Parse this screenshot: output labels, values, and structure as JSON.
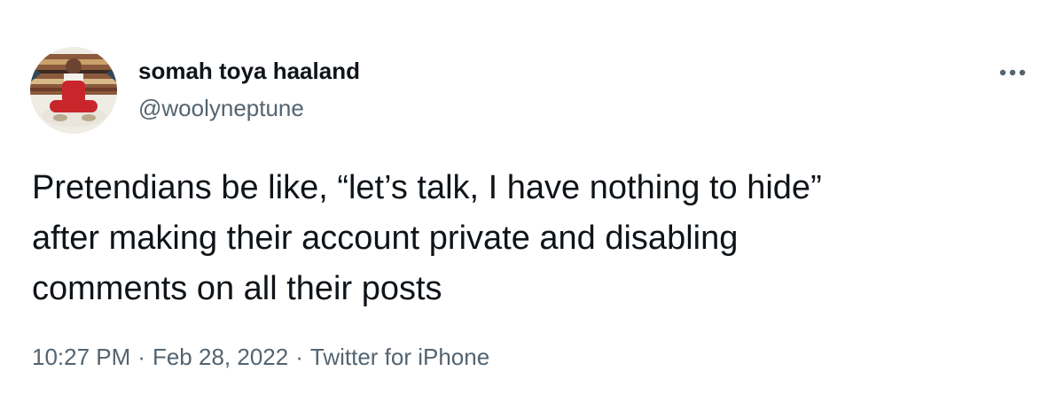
{
  "author": {
    "display_name": "somah toya haaland",
    "handle": "@woolyneptune",
    "avatar": "avatar-photo"
  },
  "more_menu": {
    "icon": "more-horizontal-icon"
  },
  "tweet": {
    "text_lines": [
      "Pretendians be like, “let’s talk, I have nothing to hide”",
      "after making their account private and disabling",
      "comments on all their posts"
    ]
  },
  "meta": {
    "time": "10:27 PM",
    "separator": "·",
    "date": "Feb 28, 2022",
    "source": "Twitter for iPhone"
  },
  "colors": {
    "text_primary": "#0f1419",
    "text_secondary": "#536471",
    "background": "#ffffff"
  }
}
